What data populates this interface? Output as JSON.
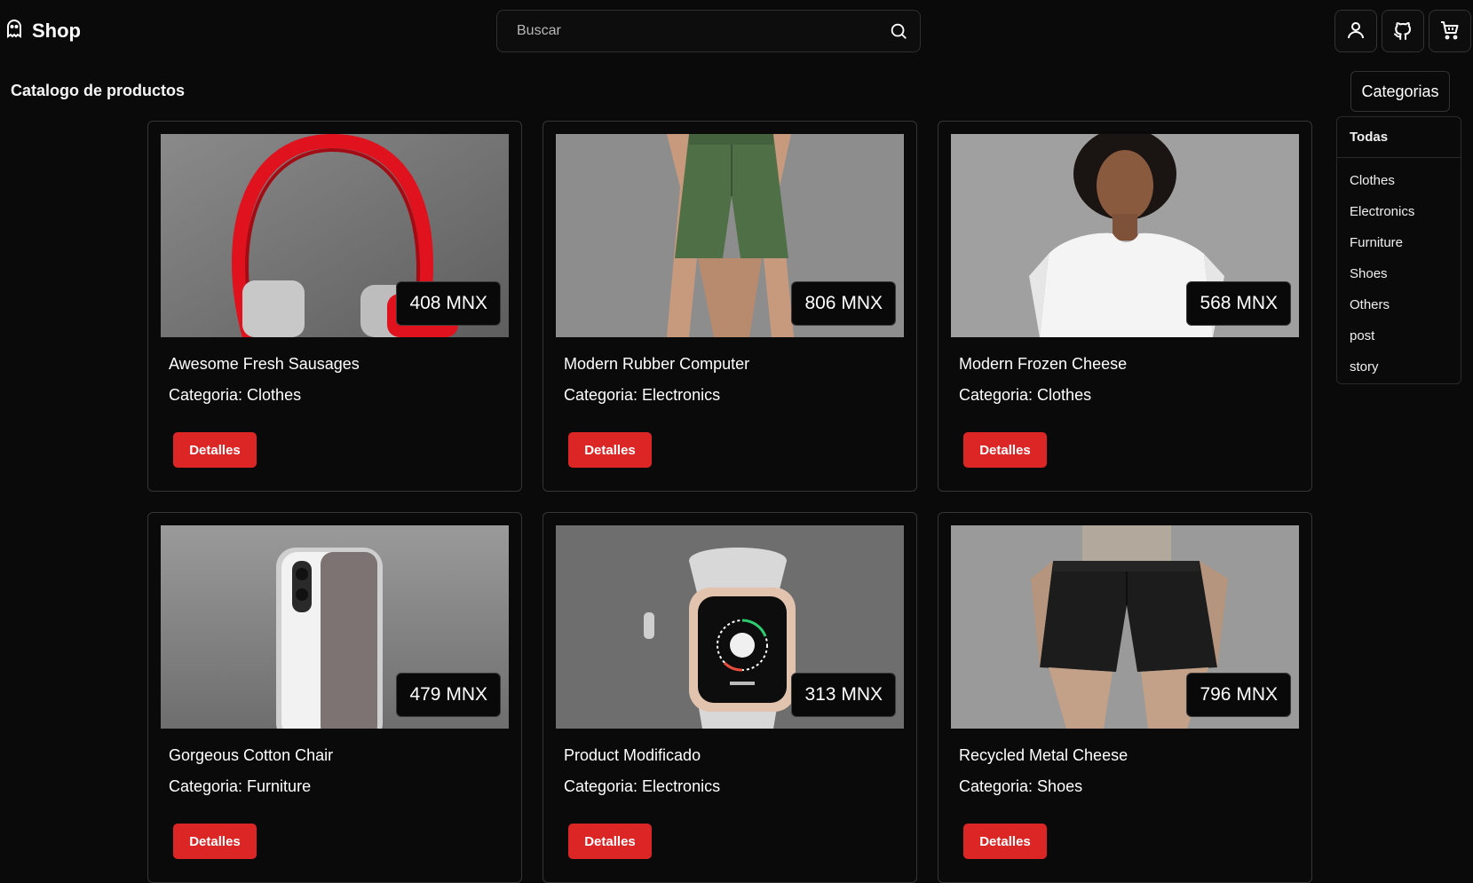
{
  "brand": {
    "name": "Shop",
    "logo_icon": "ghost-icon"
  },
  "search": {
    "placeholder": "Buscar",
    "value": "",
    "icon": "search-icon"
  },
  "header_actions": [
    {
      "name": "account-button",
      "icon": "user-icon"
    },
    {
      "name": "github-button",
      "icon": "github-icon"
    },
    {
      "name": "cart-button",
      "icon": "cart-icon"
    }
  ],
  "page": {
    "title": "Catalogo de productos"
  },
  "categories": {
    "button_label": "Categorias",
    "selected": "Todas",
    "items": [
      "Clothes",
      "Electronics",
      "Furniture",
      "Shoes",
      "Others",
      "post",
      "story"
    ]
  },
  "products": [
    {
      "title": "Awesome Fresh Sausages",
      "category": "Categoria: Clothes",
      "price": "408 MNX",
      "button": "Detalles",
      "image": "red-headphones"
    },
    {
      "title": "Modern Rubber Computer",
      "category": "Categoria: Electronics",
      "price": "806 MNX",
      "button": "Detalles",
      "image": "green-shorts"
    },
    {
      "title": "Modern Frozen Cheese",
      "category": "Categoria: Clothes",
      "price": "568 MNX",
      "button": "Detalles",
      "image": "white-tshirt"
    },
    {
      "title": "Gorgeous Cotton Chair",
      "category": "Categoria: Furniture",
      "price": "479 MNX",
      "button": "Detalles",
      "image": "smartphone"
    },
    {
      "title": "Product Modificado",
      "category": "Categoria: Electronics",
      "price": "313 MNX",
      "button": "Detalles",
      "image": "smartwatch"
    },
    {
      "title": "Recycled Metal Cheese",
      "category": "Categoria: Shoes",
      "price": "796 MNX",
      "button": "Detalles",
      "image": "black-shorts"
    }
  ],
  "colors": {
    "background": "#0a0a0a",
    "accent": "#dc2626",
    "border": "#353535",
    "text": "#ffffff"
  }
}
